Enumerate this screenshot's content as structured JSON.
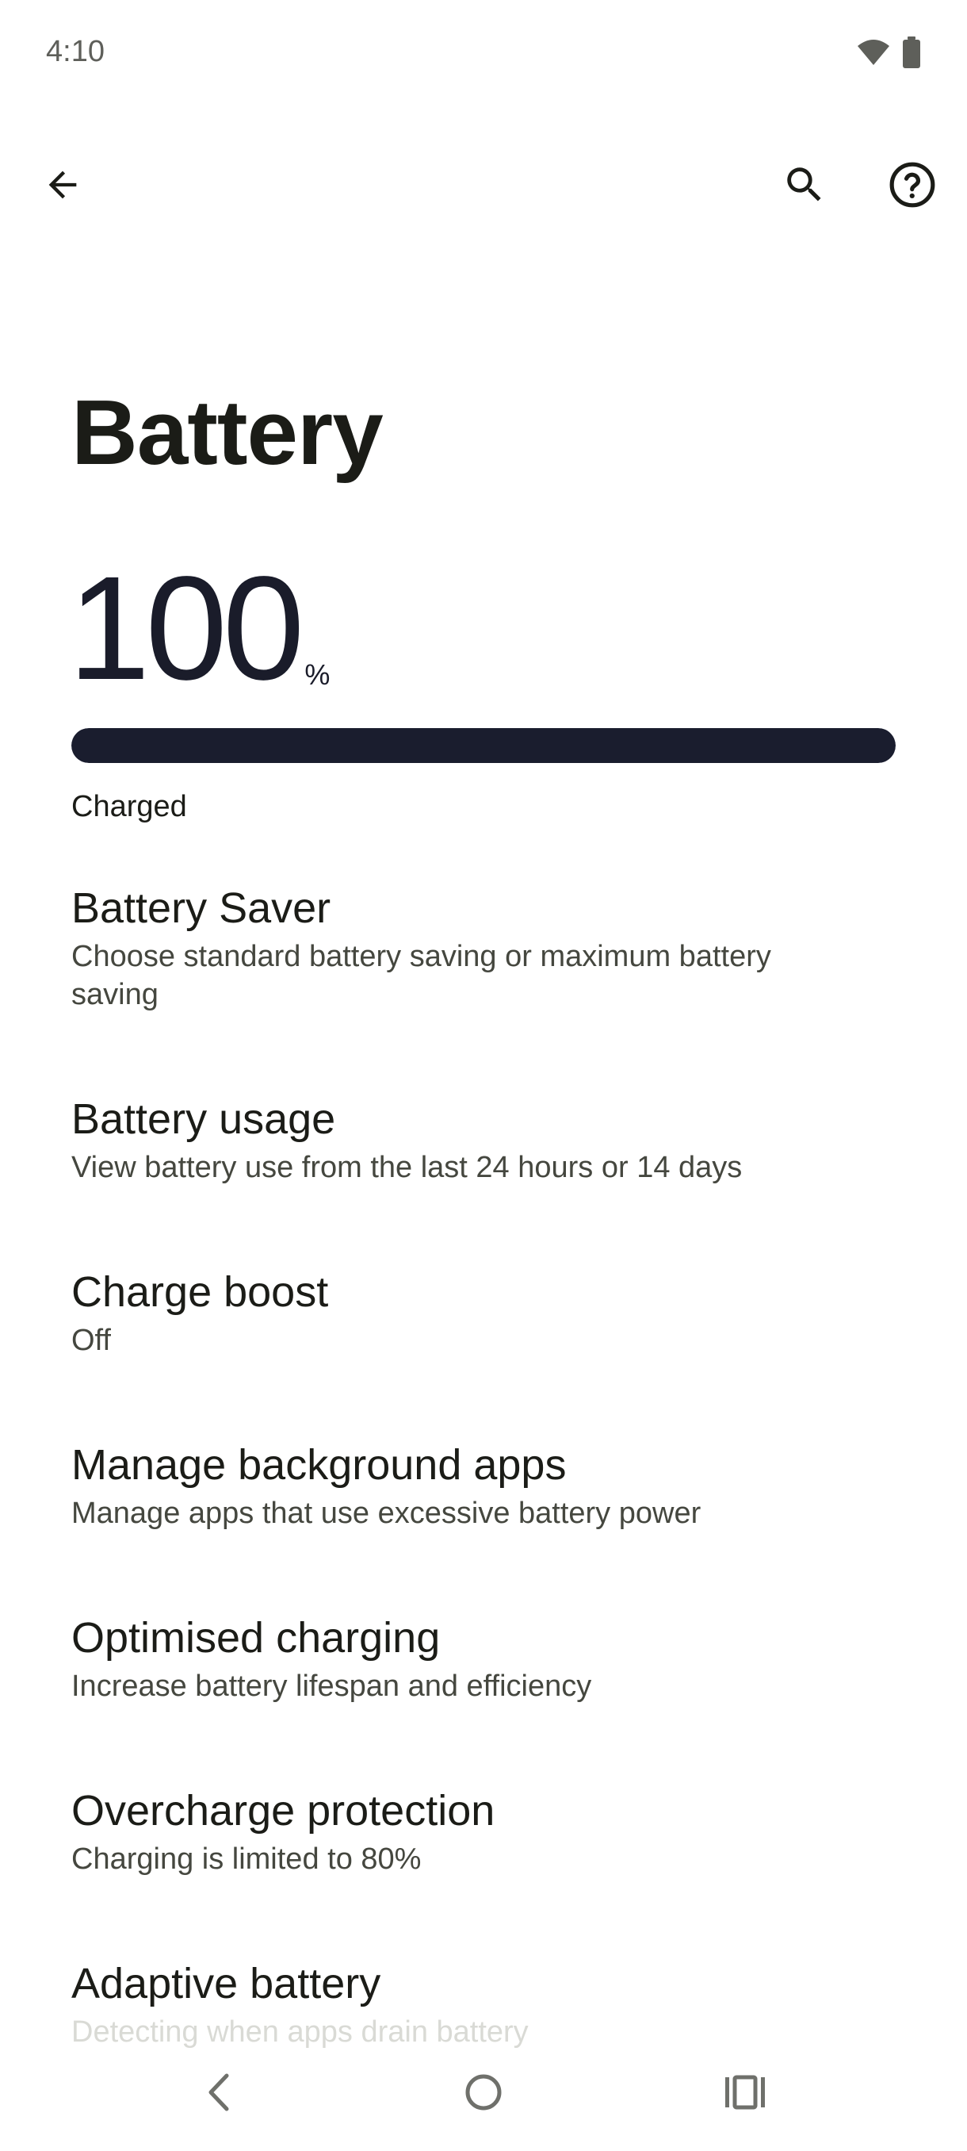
{
  "status_bar": {
    "time": "4:10",
    "icons": [
      "wifi-icon",
      "battery-icon"
    ]
  },
  "top_bar": {
    "back_icon": "arrow-back-icon",
    "search_icon": "search-icon",
    "help_icon": "help-icon"
  },
  "page": {
    "title": "Battery"
  },
  "battery": {
    "level": "100",
    "unit": "%",
    "level_fraction": 1.0,
    "status": "Charged"
  },
  "settings": [
    {
      "title": "Battery Saver",
      "summary": "Choose standard battery saving or maximum battery saving"
    },
    {
      "title": "Battery usage",
      "summary": "View battery use from the last 24 hours or 14 days"
    },
    {
      "title": "Charge boost",
      "summary": "Off"
    },
    {
      "title": "Manage background apps",
      "summary": "Manage apps that use excessive battery power"
    },
    {
      "title": "Optimised charging",
      "summary": "Increase battery lifespan and efficiency"
    },
    {
      "title": "Overcharge protection",
      "summary": "Charging is limited to 80%"
    },
    {
      "title": "Adaptive battery",
      "summary": "Detecting when apps drain battery"
    }
  ],
  "nav_bar": {
    "back_icon": "nav-back-icon",
    "home_icon": "nav-home-icon",
    "recents_icon": "nav-recents-icon"
  },
  "colors": {
    "progress_fill": "#1a1d2e",
    "text_primary": "#1b1c17",
    "text_secondary": "#45473f"
  }
}
